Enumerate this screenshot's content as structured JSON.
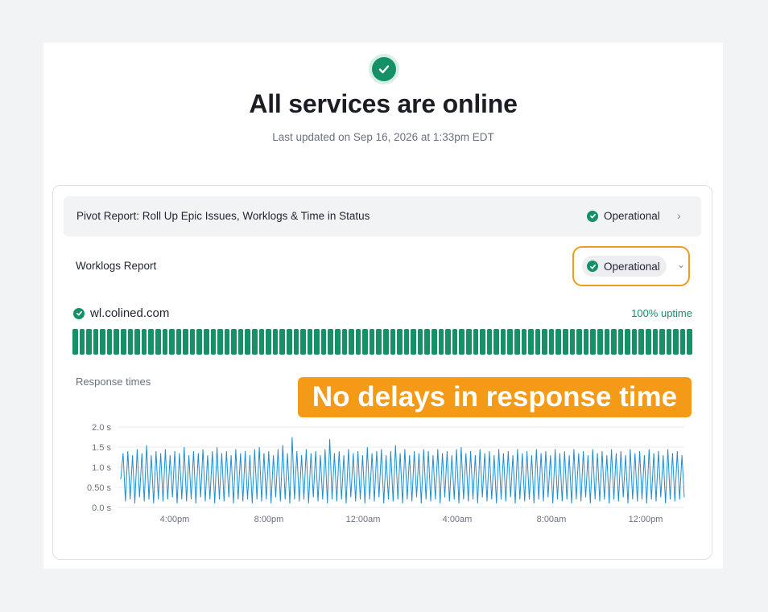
{
  "header": {
    "icon": "check-circle-icon",
    "title": "All services are online",
    "subtitle": "Last updated on Sep 16, 2026 at 1:33pm EDT"
  },
  "services": [
    {
      "name": "Pivot Report: Roll Up Epic Issues, Worklogs & Time in Status",
      "status": "Operational",
      "expanded": false
    },
    {
      "name": "Worklogs Report",
      "status": "Operational",
      "expanded": true
    }
  ],
  "detail": {
    "domain": "wl.colined.com",
    "uptime": "100% uptime",
    "bar_count": 90,
    "response_times_label": "Response times",
    "annotation": "No delays in response time"
  },
  "colors": {
    "operational": "#169066",
    "highlight": "#f29a1c",
    "line": "#1d8fd1"
  },
  "chart_data": {
    "type": "line",
    "title": "",
    "xlabel": "",
    "ylabel": "",
    "y_ticks": [
      "2.0 s",
      "1.5 s",
      "1.0 s",
      "0.50 s",
      "0.0 s"
    ],
    "y_tick_values": [
      2.0,
      1.5,
      1.0,
      0.5,
      0.0
    ],
    "x_ticks": [
      "4:00pm",
      "8:00pm",
      "12:00am",
      "4:00am",
      "8:00am",
      "12:00pm"
    ],
    "ylim": [
      0,
      2.0
    ],
    "grid": true,
    "series": [
      {
        "values": [
          0.7,
          1.35,
          0.15,
          1.4,
          0.2,
          1.3,
          0.1,
          1.45,
          0.25,
          1.35,
          0.15,
          1.55,
          0.2,
          1.3,
          0.1,
          1.4,
          0.2,
          1.35,
          0.15,
          1.45,
          0.2,
          1.3,
          0.25,
          1.4,
          0.1,
          1.35,
          0.2,
          1.5,
          0.15,
          1.3,
          0.2,
          1.4,
          0.1,
          1.35,
          0.25,
          1.45,
          0.15,
          1.3,
          0.2,
          1.4,
          0.1,
          1.5,
          0.2,
          1.35,
          0.15,
          1.4,
          0.25,
          1.3,
          0.1,
          1.45,
          0.2,
          1.35,
          0.15,
          1.4,
          0.2,
          1.3,
          0.1,
          1.45,
          0.2,
          1.5,
          0.15,
          1.35,
          0.2,
          1.4,
          0.1,
          1.3,
          0.25,
          1.45,
          0.15,
          1.55,
          0.2,
          1.35,
          0.1,
          1.75,
          0.2,
          1.4,
          0.15,
          1.3,
          0.2,
          1.45,
          0.1,
          1.35,
          0.25,
          1.4,
          0.15,
          1.3,
          0.2,
          1.45,
          0.1,
          1.7,
          0.2,
          1.35,
          0.15,
          1.4,
          0.2,
          1.3,
          0.1,
          1.45,
          0.25,
          1.35,
          0.15,
          1.4,
          0.2,
          1.3,
          0.1,
          1.5,
          0.2,
          1.35,
          0.15,
          1.4,
          0.25,
          1.45,
          0.1,
          1.3,
          0.2,
          1.4,
          0.15,
          1.55,
          0.2,
          1.35,
          0.1,
          1.45,
          0.2,
          1.3,
          0.15,
          1.4,
          0.25,
          1.35,
          0.1,
          1.45,
          0.2,
          1.4,
          0.15,
          1.3,
          0.2,
          1.45,
          0.1,
          1.35,
          0.25,
          1.4,
          0.15,
          1.3,
          0.2,
          1.45,
          0.1,
          1.5,
          0.2,
          1.35,
          0.15,
          1.4,
          0.2,
          1.3,
          0.1,
          1.45,
          0.25,
          1.35,
          0.15,
          1.4,
          0.2,
          1.3,
          0.1,
          1.45,
          0.2,
          1.35,
          0.15,
          1.4,
          0.25,
          1.3,
          0.1,
          1.45,
          0.2,
          1.35,
          0.15,
          1.4,
          0.2,
          1.3,
          0.1,
          1.45,
          0.2,
          1.35,
          0.15,
          1.4,
          0.25,
          1.3,
          0.1,
          1.45,
          0.2,
          1.35,
          0.15,
          1.4,
          0.2,
          1.3,
          0.1,
          1.45,
          0.2,
          1.35,
          0.15,
          1.4,
          0.25,
          1.3,
          0.1,
          1.45,
          0.2,
          1.35,
          0.15,
          1.4,
          0.2,
          1.3,
          0.1,
          1.45,
          0.2,
          1.35,
          0.15,
          1.4,
          0.25,
          1.3,
          0.1,
          1.45,
          0.2,
          1.35,
          0.15,
          1.4,
          0.2,
          1.3,
          0.1,
          1.45,
          0.2,
          1.35,
          0.15,
          1.4,
          0.25,
          1.3,
          0.1,
          1.45,
          0.2,
          1.35,
          0.15,
          1.4,
          0.2,
          1.3,
          0.25
        ]
      }
    ]
  }
}
